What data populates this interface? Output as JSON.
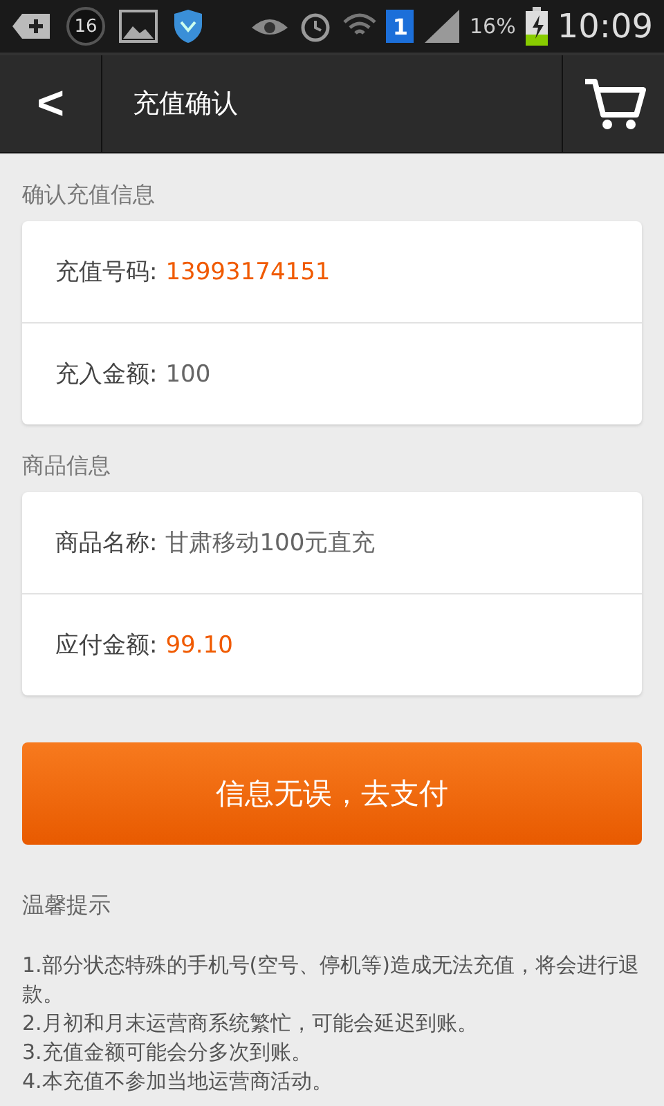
{
  "status_bar": {
    "notification_count": "16",
    "sim_badge": "1",
    "battery_percent": "16%",
    "time": "10:09"
  },
  "header": {
    "back": "<",
    "title": "充值确认"
  },
  "sections": [
    {
      "title": "确认充值信息",
      "rows": [
        {
          "label": "充值号码:",
          "value": "13993174151",
          "highlight": true
        },
        {
          "label": "充入金额:",
          "value": "100",
          "highlight": false
        }
      ]
    },
    {
      "title": "商品信息",
      "rows": [
        {
          "label": "商品名称:",
          "value": "甘肃移动100元直充",
          "highlight": false
        },
        {
          "label": "应付金额:",
          "value": "99.10",
          "highlight": true
        }
      ]
    }
  ],
  "pay_button": "信息无误，去支付",
  "tips": {
    "title": "温馨提示",
    "lines": [
      "1.部分状态特殊的手机号(空号、停机等)造成无法充值，将会进行退款。",
      "2.月初和月末运营商系统繁忙，可能会延迟到账。",
      "3.充值金额可能会分多次到账。",
      "4.本充值不参加当地运营商活动。"
    ]
  }
}
